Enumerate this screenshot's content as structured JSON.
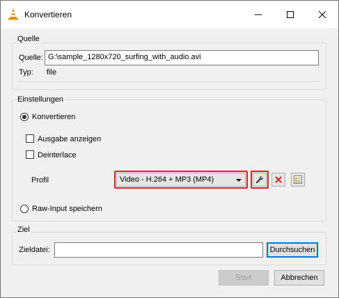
{
  "window": {
    "title": "Konvertieren"
  },
  "source_group": {
    "label": "Quelle",
    "source_label": "Quelle:",
    "source_value": "G:\\sample_1280x720_surfing_with_audio.avi",
    "type_label": "Typ:",
    "type_value": "file"
  },
  "settings_group": {
    "label": "Einstellungen",
    "convert_label": "Konvertieren",
    "show_output_label": "Ausgabe anzeigen",
    "deinterlace_label": "Deinterlace",
    "profile_label": "Profil",
    "profile_value": "Video - H.264 + MP3 (MP4)",
    "raw_input_label": "Raw-Input speichern"
  },
  "target_group": {
    "label": "Ziel",
    "target_file_label": "Zieldatei:",
    "target_file_value": "",
    "browse_label": "Durchsuchen"
  },
  "footer": {
    "start_label": "Start",
    "cancel_label": "Abbrechen"
  },
  "colors": {
    "highlight": "#e02020",
    "focus": "#0078d7",
    "delete_icon": "#e02020"
  }
}
